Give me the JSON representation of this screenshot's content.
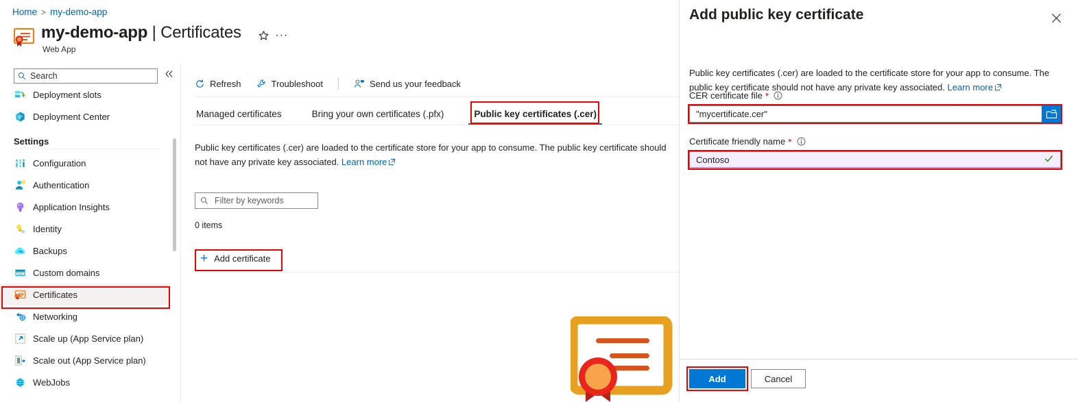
{
  "breadcrumb": {
    "home": "Home",
    "separator": ">",
    "current": "my-demo-app"
  },
  "header": {
    "resource_name": "my-demo-app",
    "title_separator": " | ",
    "blade_name": "Certificates",
    "subtitle": "Web App",
    "favorite_icon": "star-icon",
    "more_icon": "ellipsis-icon",
    "resource_icon": "certificate-icon"
  },
  "sidebar": {
    "search_placeholder": "Search",
    "search_icon": "search-icon",
    "collapse_icon": "double-chevron-left-icon",
    "top_items": [
      {
        "label": "Deployment slots",
        "icon": "deployment-slots-icon"
      },
      {
        "label": "Deployment Center",
        "icon": "deployment-center-icon"
      }
    ],
    "section_label": "Settings",
    "items": [
      {
        "label": "Configuration",
        "icon": "configuration-icon"
      },
      {
        "label": "Authentication",
        "icon": "authentication-icon"
      },
      {
        "label": "Application Insights",
        "icon": "application-insights-icon"
      },
      {
        "label": "Identity",
        "icon": "identity-key-icon"
      },
      {
        "label": "Backups",
        "icon": "backups-cloud-icon"
      },
      {
        "label": "Custom domains",
        "icon": "custom-domains-icon"
      },
      {
        "label": "Certificates",
        "icon": "certificate-icon",
        "selected": true
      },
      {
        "label": "Networking",
        "icon": "networking-icon"
      },
      {
        "label": "Scale up (App Service plan)",
        "icon": "scale-up-icon"
      },
      {
        "label": "Scale out (App Service plan)",
        "icon": "scale-out-icon"
      },
      {
        "label": "WebJobs",
        "icon": "webjobs-icon"
      }
    ]
  },
  "toolbar": {
    "refresh": "Refresh",
    "refresh_icon": "refresh-icon",
    "troubleshoot": "Troubleshoot",
    "troubleshoot_icon": "wrench-icon",
    "feedback": "Send us your feedback",
    "feedback_icon": "person-feedback-icon"
  },
  "tabs": [
    {
      "label": "Managed certificates",
      "active": false
    },
    {
      "label": "Bring your own certificates (.pfx)",
      "active": false
    },
    {
      "label": "Public key certificates (.cer)",
      "active": true
    }
  ],
  "main": {
    "description": "Public key certificates (.cer) are loaded to the certificate store for your app to consume. The public key certificate should not have any private key associated.",
    "learn_more": "Learn more",
    "external_link_icon": "external-link-icon",
    "filter_placeholder": "Filter by keywords",
    "filter_icon": "search-icon",
    "item_count": "0 items",
    "add_certificate": "Add certificate",
    "add_icon": "plus-icon",
    "illustration_icon": "certificate-illustration"
  },
  "panel": {
    "title": "Add public key certificate",
    "close_icon": "close-icon",
    "description": "Public key certificates (.cer) are loaded to the certificate store for your app to consume. The public key certificate should not have any private key associated.",
    "learn_more": "Learn more",
    "fields": {
      "cer_file": {
        "label": "CER certificate file",
        "required_marker": "*",
        "info_icon": "info-icon",
        "value": "\"mycertificate.cer\"",
        "browse_icon": "folder-open-icon"
      },
      "friendly_name": {
        "label": "Certificate friendly name",
        "required_marker": "*",
        "info_icon": "info-icon",
        "value": "Contoso",
        "valid_icon": "checkmark-icon"
      }
    },
    "add_button": "Add",
    "cancel_button": "Cancel"
  },
  "colors": {
    "accent": "#0078d4",
    "link": "#0063b1",
    "highlight": "#ee0000",
    "required": "#a4262c",
    "valid": "#107c10"
  }
}
